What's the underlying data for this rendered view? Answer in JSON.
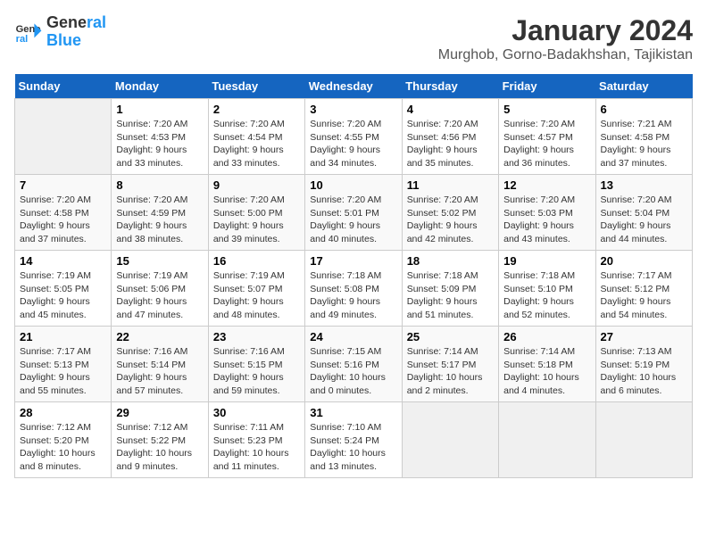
{
  "logo": {
    "line1": "General",
    "line2": "Blue"
  },
  "title": "January 2024",
  "subtitle": "Murghob, Gorno-Badakhshan, Tajikistan",
  "headers": [
    "Sunday",
    "Monday",
    "Tuesday",
    "Wednesday",
    "Thursday",
    "Friday",
    "Saturday"
  ],
  "weeks": [
    [
      {
        "day": "",
        "info": ""
      },
      {
        "day": "1",
        "info": "Sunrise: 7:20 AM\nSunset: 4:53 PM\nDaylight: 9 hours\nand 33 minutes."
      },
      {
        "day": "2",
        "info": "Sunrise: 7:20 AM\nSunset: 4:54 PM\nDaylight: 9 hours\nand 33 minutes."
      },
      {
        "day": "3",
        "info": "Sunrise: 7:20 AM\nSunset: 4:55 PM\nDaylight: 9 hours\nand 34 minutes."
      },
      {
        "day": "4",
        "info": "Sunrise: 7:20 AM\nSunset: 4:56 PM\nDaylight: 9 hours\nand 35 minutes."
      },
      {
        "day": "5",
        "info": "Sunrise: 7:20 AM\nSunset: 4:57 PM\nDaylight: 9 hours\nand 36 minutes."
      },
      {
        "day": "6",
        "info": "Sunrise: 7:21 AM\nSunset: 4:58 PM\nDaylight: 9 hours\nand 37 minutes."
      }
    ],
    [
      {
        "day": "7",
        "info": "Sunrise: 7:20 AM\nSunset: 4:58 PM\nDaylight: 9 hours\nand 37 minutes."
      },
      {
        "day": "8",
        "info": "Sunrise: 7:20 AM\nSunset: 4:59 PM\nDaylight: 9 hours\nand 38 minutes."
      },
      {
        "day": "9",
        "info": "Sunrise: 7:20 AM\nSunset: 5:00 PM\nDaylight: 9 hours\nand 39 minutes."
      },
      {
        "day": "10",
        "info": "Sunrise: 7:20 AM\nSunset: 5:01 PM\nDaylight: 9 hours\nand 40 minutes."
      },
      {
        "day": "11",
        "info": "Sunrise: 7:20 AM\nSunset: 5:02 PM\nDaylight: 9 hours\nand 42 minutes."
      },
      {
        "day": "12",
        "info": "Sunrise: 7:20 AM\nSunset: 5:03 PM\nDaylight: 9 hours\nand 43 minutes."
      },
      {
        "day": "13",
        "info": "Sunrise: 7:20 AM\nSunset: 5:04 PM\nDaylight: 9 hours\nand 44 minutes."
      }
    ],
    [
      {
        "day": "14",
        "info": "Sunrise: 7:19 AM\nSunset: 5:05 PM\nDaylight: 9 hours\nand 45 minutes."
      },
      {
        "day": "15",
        "info": "Sunrise: 7:19 AM\nSunset: 5:06 PM\nDaylight: 9 hours\nand 47 minutes."
      },
      {
        "day": "16",
        "info": "Sunrise: 7:19 AM\nSunset: 5:07 PM\nDaylight: 9 hours\nand 48 minutes."
      },
      {
        "day": "17",
        "info": "Sunrise: 7:18 AM\nSunset: 5:08 PM\nDaylight: 9 hours\nand 49 minutes."
      },
      {
        "day": "18",
        "info": "Sunrise: 7:18 AM\nSunset: 5:09 PM\nDaylight: 9 hours\nand 51 minutes."
      },
      {
        "day": "19",
        "info": "Sunrise: 7:18 AM\nSunset: 5:10 PM\nDaylight: 9 hours\nand 52 minutes."
      },
      {
        "day": "20",
        "info": "Sunrise: 7:17 AM\nSunset: 5:12 PM\nDaylight: 9 hours\nand 54 minutes."
      }
    ],
    [
      {
        "day": "21",
        "info": "Sunrise: 7:17 AM\nSunset: 5:13 PM\nDaylight: 9 hours\nand 55 minutes."
      },
      {
        "day": "22",
        "info": "Sunrise: 7:16 AM\nSunset: 5:14 PM\nDaylight: 9 hours\nand 57 minutes."
      },
      {
        "day": "23",
        "info": "Sunrise: 7:16 AM\nSunset: 5:15 PM\nDaylight: 9 hours\nand 59 minutes."
      },
      {
        "day": "24",
        "info": "Sunrise: 7:15 AM\nSunset: 5:16 PM\nDaylight: 10 hours\nand 0 minutes."
      },
      {
        "day": "25",
        "info": "Sunrise: 7:14 AM\nSunset: 5:17 PM\nDaylight: 10 hours\nand 2 minutes."
      },
      {
        "day": "26",
        "info": "Sunrise: 7:14 AM\nSunset: 5:18 PM\nDaylight: 10 hours\nand 4 minutes."
      },
      {
        "day": "27",
        "info": "Sunrise: 7:13 AM\nSunset: 5:19 PM\nDaylight: 10 hours\nand 6 minutes."
      }
    ],
    [
      {
        "day": "28",
        "info": "Sunrise: 7:12 AM\nSunset: 5:20 PM\nDaylight: 10 hours\nand 8 minutes."
      },
      {
        "day": "29",
        "info": "Sunrise: 7:12 AM\nSunset: 5:22 PM\nDaylight: 10 hours\nand 9 minutes."
      },
      {
        "day": "30",
        "info": "Sunrise: 7:11 AM\nSunset: 5:23 PM\nDaylight: 10 hours\nand 11 minutes."
      },
      {
        "day": "31",
        "info": "Sunrise: 7:10 AM\nSunset: 5:24 PM\nDaylight: 10 hours\nand 13 minutes."
      },
      {
        "day": "",
        "info": ""
      },
      {
        "day": "",
        "info": ""
      },
      {
        "day": "",
        "info": ""
      }
    ]
  ]
}
